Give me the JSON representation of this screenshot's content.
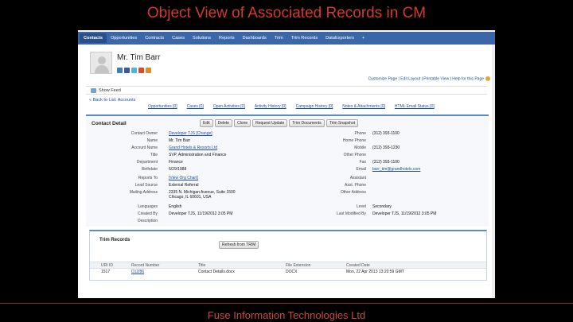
{
  "slide": {
    "title": "Object View of Associated Records in CM",
    "footer": "Fuse Information Technologies Ltd"
  },
  "tabs": [
    {
      "label": "Contacts",
      "active": true
    },
    {
      "label": "Opportunities"
    },
    {
      "label": "Contracts"
    },
    {
      "label": "Cases"
    },
    {
      "label": "Solutions"
    },
    {
      "label": "Reports"
    },
    {
      "label": "Dashboards"
    },
    {
      "label": "Trim"
    },
    {
      "label": "Trim Records"
    },
    {
      "label": "DataExporters"
    },
    {
      "label": "+"
    }
  ],
  "header": {
    "name": "Mr. Tim Barr",
    "links": "Customize Page | Edit Layout | Printable View | Help for this Page"
  },
  "feed": {
    "label": "Show Feed"
  },
  "back_link": "« Back to List: Accounts",
  "related_links": [
    "Opportunities [0]",
    "Cases [0]",
    "Open Activities [0]",
    "Activity History [0]",
    "Campaign History [0]",
    "Notes & Attachments [0]",
    "HTML Email Status [0]"
  ],
  "detail": {
    "title": "Contact Detail",
    "buttons": [
      "Edit",
      "Delete",
      "Clone",
      "Request Update",
      "Trim Documents",
      "Trim Snapshot"
    ],
    "left": [
      {
        "label": "Contact Owner",
        "value": "Developer TJS [Change]",
        "link": true
      },
      {
        "label": "Name",
        "value": "Mr. Tim Barr"
      },
      {
        "label": "Account Name",
        "value": "Grand Hotels & Resorts Ltd",
        "link": true
      },
      {
        "label": "Title",
        "value": "SVP, Administration and Finance"
      },
      {
        "label": "Department",
        "value": "Finance"
      },
      {
        "label": "Birthdate",
        "value": "6/29/1988"
      },
      {
        "label": "Reports To",
        "value": "[View Org Chart]",
        "link": true
      },
      {
        "label": "Lead Source",
        "value": "External Referral"
      },
      {
        "label": "Mailing Address",
        "value": "2335 N. Michigan Avenue, Suite 1500",
        "value2": "Chicago, IL 60601, USA"
      },
      {
        "label": "Languages",
        "value": "English"
      },
      {
        "label": "Created By",
        "value": "Developer TJS, 11/19/2012 3:05 PM"
      },
      {
        "label": "Description",
        "value": ""
      }
    ],
    "right": [
      {
        "label": "Phone",
        "value": "(312) 393-1100"
      },
      {
        "label": "Home Phone",
        "value": ""
      },
      {
        "label": "Mobile",
        "value": "(312) 393-1230"
      },
      {
        "label": "Other Phone",
        "value": ""
      },
      {
        "label": "Fax",
        "value": "(312) 393-1100"
      },
      {
        "label": "Email",
        "value": "barr_tim@grandhotels.com",
        "link": true
      },
      {
        "label": "Assistant",
        "value": ""
      },
      {
        "label": "Asst. Phone",
        "value": ""
      },
      {
        "label": "Other Address",
        "value": ""
      },
      {
        "label": "Level",
        "value": "Secondary"
      },
      {
        "label": "Last Modified By",
        "value": "Developer TJS, 11/19/2012 3:05 PM"
      }
    ]
  },
  "trim": {
    "title": "Trim Records",
    "refresh_label": "Refresh from TRIM",
    "columns": [
      "URI ID",
      "Record Number",
      "Title",
      "File Extension",
      "Created Date"
    ],
    "rows": [
      [
        "1517",
        "D12/86",
        "Contact Details.docx",
        "DOCX",
        "Mon, 22 Apr 2013 13:20:59 GMT"
      ]
    ]
  },
  "colors": {
    "tabbar": "#3b66a8",
    "section_accent": "#5b8bc7",
    "link": "#1d4f9a",
    "slide_title": "#d23a2a"
  }
}
